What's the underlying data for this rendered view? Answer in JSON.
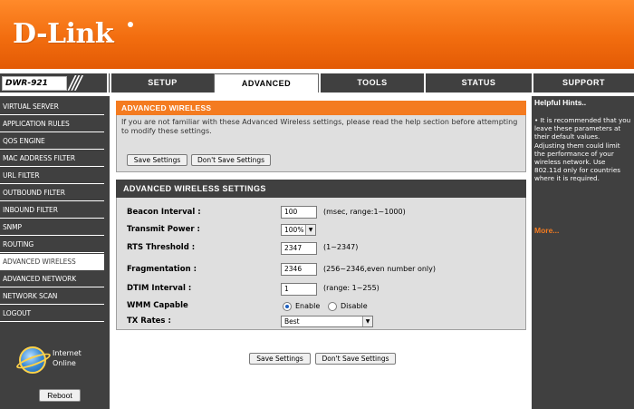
{
  "brand": {
    "logo_text": "D-Link",
    "model": "DWR-921",
    "accent": "#f47b20",
    "dark": "#404040"
  },
  "nav": {
    "tabs": [
      {
        "label": "SETUP",
        "active": false
      },
      {
        "label": "ADVANCED",
        "active": true
      },
      {
        "label": "TOOLS",
        "active": false
      },
      {
        "label": "STATUS",
        "active": false
      },
      {
        "label": "SUPPORT",
        "active": false
      }
    ]
  },
  "sidebar": {
    "items": [
      {
        "label": "VIRTUAL SERVER",
        "active": false
      },
      {
        "label": "APPLICATION RULES",
        "active": false
      },
      {
        "label": "QOS ENGINE",
        "active": false
      },
      {
        "label": "MAC ADDRESS FILTER",
        "active": false
      },
      {
        "label": "URL FILTER",
        "active": false
      },
      {
        "label": "OUTBOUND FILTER",
        "active": false
      },
      {
        "label": "INBOUND FILTER",
        "active": false
      },
      {
        "label": "SNMP",
        "active": false
      },
      {
        "label": "ROUTING",
        "active": false
      },
      {
        "label": "ADVANCED WIRELESS",
        "active": true
      },
      {
        "label": "ADVANCED NETWORK",
        "active": false
      },
      {
        "label": "NETWORK SCAN",
        "active": false
      },
      {
        "label": "LOGOUT",
        "active": false
      }
    ],
    "internet_status_line1": "Internet",
    "internet_status_line2": "Online",
    "reboot_label": "Reboot"
  },
  "intro": {
    "title": "ADVANCED WIRELESS",
    "text": "If you are not familiar with these Advanced Wireless settings, please read the help section before attempting to modify these settings.",
    "save_label": "Save Settings",
    "dont_save_label": "Don't Save Settings"
  },
  "settings": {
    "title": "ADVANCED WIRELESS SETTINGS",
    "beacon_label": "Beacon Interval :",
    "beacon_value": "100",
    "beacon_hint": "(msec, range:1~1000)",
    "power_label": "Transmit Power :",
    "power_value": "100%",
    "rts_label": "RTS Threshold :",
    "rts_value": "2347",
    "rts_hint": "(1~2347)",
    "frag_label": "Fragmentation :",
    "frag_value": "2346",
    "frag_hint": "(256~2346,even number only)",
    "dtim_label": "DTIM Interval :",
    "dtim_value": "1",
    "dtim_hint": "(range: 1~255)",
    "wmm_label": "WMM Capable",
    "wmm_enable": "Enable",
    "wmm_disable": "Disable",
    "wmm_selected": "Enable",
    "tx_label": "TX Rates :",
    "tx_value": "Best"
  },
  "footer": {
    "save_label": "Save Settings",
    "dont_save_label": "Don't Save Settings"
  },
  "hints": {
    "title": "Helpful Hints..",
    "text": "• It is recommended that you leave these parameters at their default values. Adjusting them could limit the performance of your wireless network. Use 802.11d only for countries where it is required.",
    "more": "More..."
  }
}
